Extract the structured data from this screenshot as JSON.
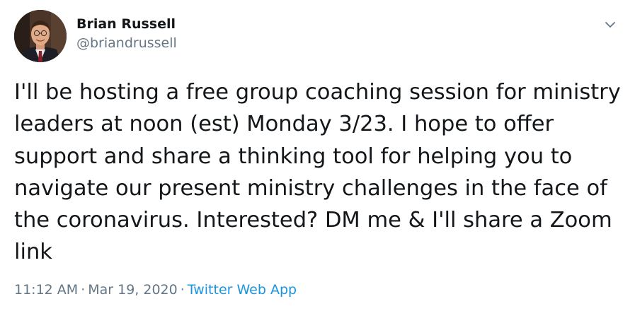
{
  "author": {
    "display_name": "Brian Russell",
    "handle": "@briandrussell"
  },
  "tweet": {
    "lines": [
      "I'll be hosting a free group coaching session for ministry",
      "leaders at noon (est) Monday 3/23. I hope to offer",
      "support and share a thinking tool for helping you to",
      "navigate our present ministry challenges in the face of",
      "the coronavirus. Interested? DM me & I'll share a Zoom",
      "link"
    ],
    "time": "11:12 AM",
    "date": "Mar 19, 2020",
    "source": "Twitter Web App",
    "separator": "·"
  },
  "icons": {
    "menu": "chevron-down-icon",
    "avatar": "profile-photo"
  },
  "colors": {
    "text": "#14171a",
    "secondary": "#657786",
    "link": "#1b95e0"
  }
}
